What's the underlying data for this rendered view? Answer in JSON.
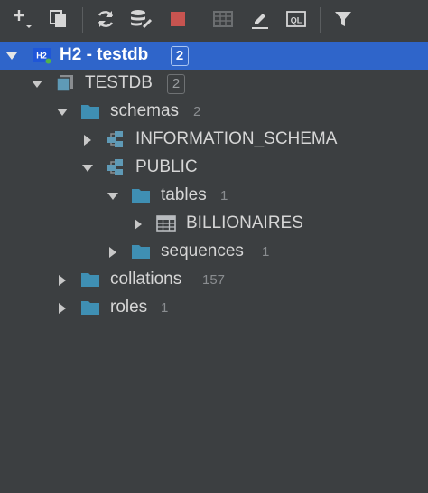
{
  "toolbar": {
    "buttons": [
      {
        "icon": "add-icon"
      },
      {
        "icon": "copy-icon"
      },
      {
        "icon": "refresh-icon"
      },
      {
        "icon": "schema-settings-icon"
      },
      {
        "icon": "stop-icon"
      },
      {
        "icon": "table-view-icon"
      },
      {
        "icon": "edit-icon"
      },
      {
        "icon": "ql-console-icon",
        "text": "QL"
      },
      {
        "icon": "filter-icon"
      }
    ]
  },
  "colors": {
    "background": "#3c3f41",
    "selection": "#2f65ca",
    "folder": "#3f8fb3",
    "stop": "#c75450",
    "count": "#8a8d90"
  },
  "tree": [
    {
      "label": "H2 - testdb",
      "count": "2",
      "icon": "h2-datasource-icon",
      "icon_text": "H2",
      "expanded": true,
      "selected": true
    },
    {
      "label": "TESTDB",
      "count": "2",
      "icon": "database-icon",
      "expanded": true
    },
    {
      "label": "schemas",
      "count": "2",
      "icon": "folder-icon",
      "expanded": true
    },
    {
      "label": "INFORMATION_SCHEMA",
      "count": "",
      "icon": "schema-icon",
      "expanded": false
    },
    {
      "label": "PUBLIC",
      "count": "",
      "icon": "schema-icon",
      "expanded": true
    },
    {
      "label": "tables",
      "count": "1",
      "icon": "folder-icon",
      "expanded": true
    },
    {
      "label": "BILLIONAIRES",
      "count": "",
      "icon": "table-icon",
      "expanded": false
    },
    {
      "label": "sequences",
      "count": "1",
      "icon": "folder-icon",
      "expanded": false
    },
    {
      "label": "collations",
      "count": "157",
      "icon": "folder-icon",
      "expanded": false
    },
    {
      "label": "roles",
      "count": "1",
      "icon": "folder-icon",
      "expanded": false
    }
  ]
}
